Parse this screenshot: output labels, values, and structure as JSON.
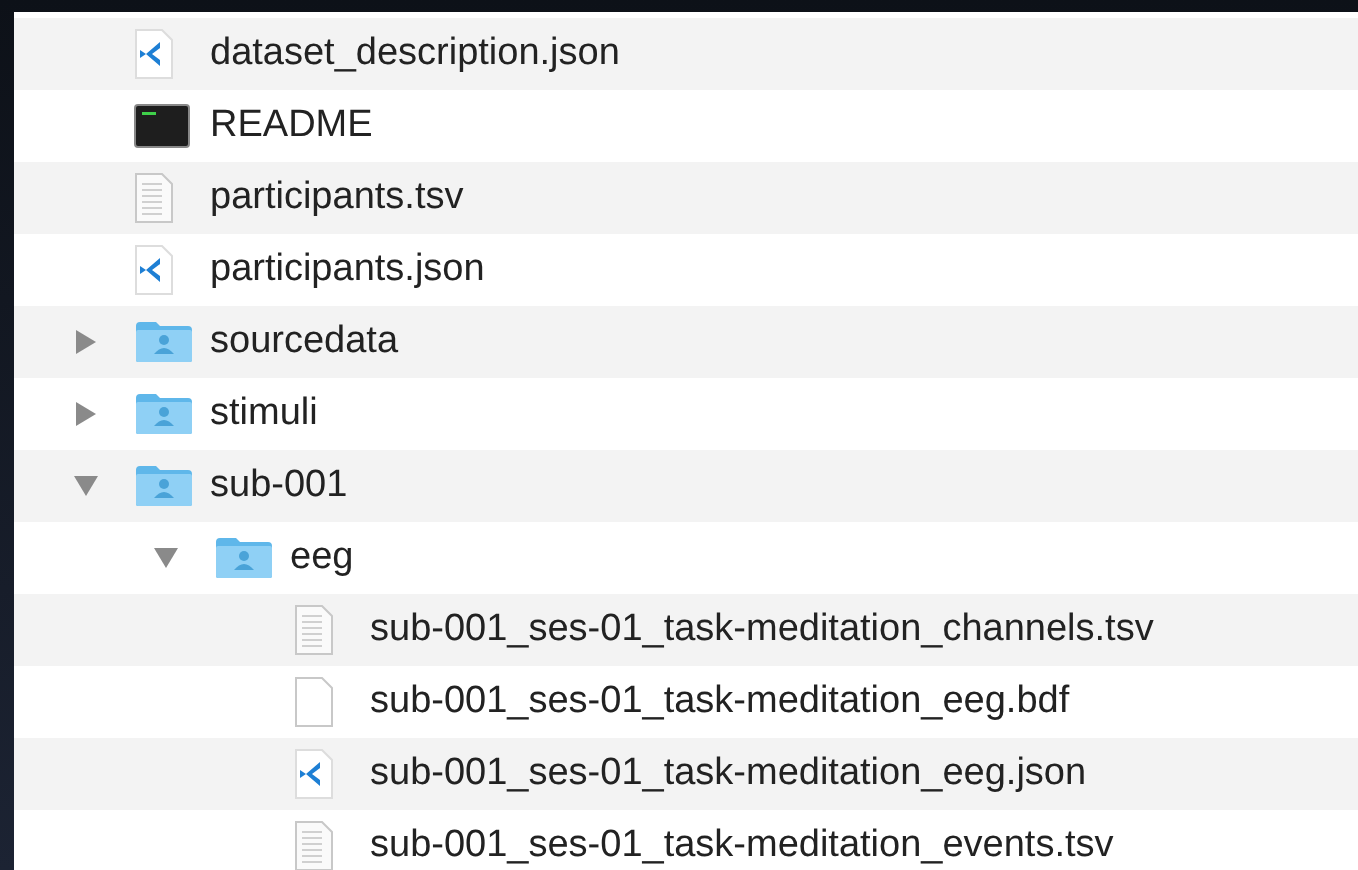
{
  "files": [
    {
      "name": "dataset_description.json",
      "kind": "vscode"
    },
    {
      "name": "README",
      "kind": "terminal"
    },
    {
      "name": "participants.tsv",
      "kind": "text"
    },
    {
      "name": "participants.json",
      "kind": "vscode"
    },
    {
      "name": "sourcedata",
      "kind": "folder",
      "expanded": false
    },
    {
      "name": "stimuli",
      "kind": "folder",
      "expanded": false
    },
    {
      "name": "sub-001",
      "kind": "folder",
      "expanded": true,
      "children": [
        {
          "name": "eeg",
          "kind": "folder",
          "expanded": true,
          "children": [
            {
              "name": "sub-001_ses-01_task-meditation_channels.tsv",
              "kind": "text"
            },
            {
              "name": "sub-001_ses-01_task-meditation_eeg.bdf",
              "kind": "blank"
            },
            {
              "name": "sub-001_ses-01_task-meditation_eeg.json",
              "kind": "vscode"
            },
            {
              "name": "sub-001_ses-01_task-meditation_events.tsv",
              "kind": "text"
            }
          ]
        }
      ]
    }
  ]
}
